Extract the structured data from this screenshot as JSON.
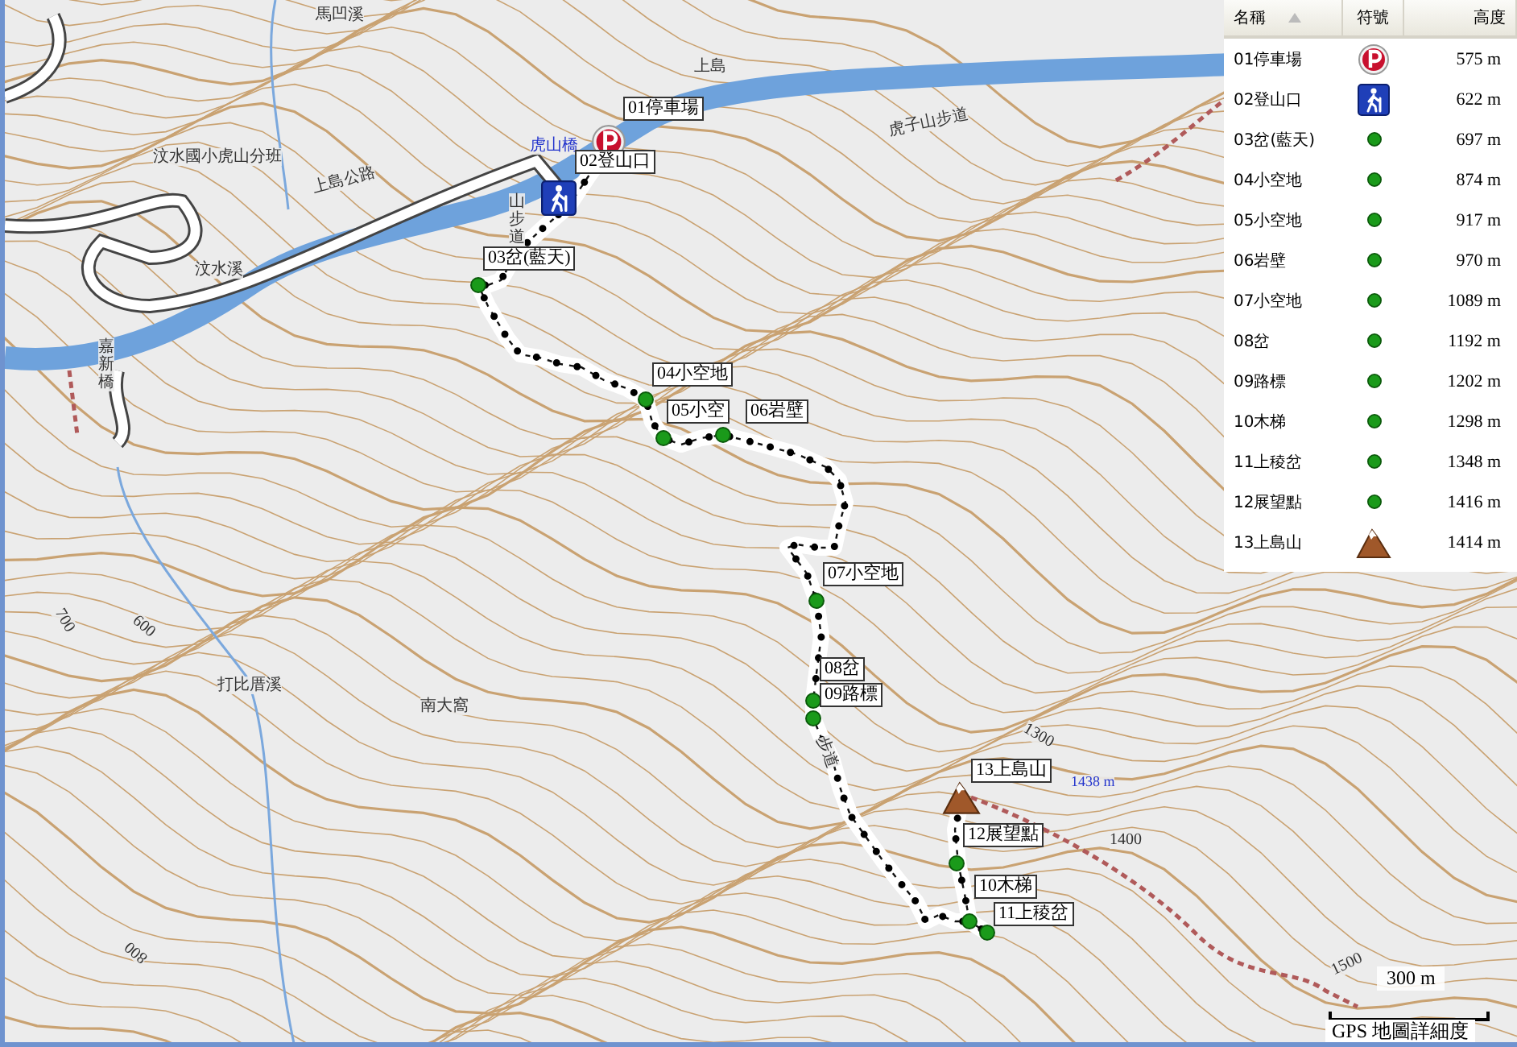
{
  "map": {
    "places": [
      {
        "text": "馬凹溪"
      },
      {
        "text": "上島"
      },
      {
        "text": "汶水國小虎山分班"
      },
      {
        "text": "虎山橋"
      },
      {
        "text": "上島公路"
      },
      {
        "text": "汶水溪"
      },
      {
        "text": "虎子山步道"
      },
      {
        "text": "山步道"
      },
      {
        "text": "嘉新橋"
      },
      {
        "text": "打比厝溪"
      },
      {
        "text": "南大窩"
      },
      {
        "text": "700"
      },
      {
        "text": "600"
      },
      {
        "text": "800"
      },
      {
        "text": "1300"
      },
      {
        "text": "1400"
      },
      {
        "text": "1500"
      },
      {
        "text": "1438 m"
      },
      {
        "text": "步道"
      }
    ],
    "waypoint_labels": [
      "01停車場",
      "02登山口",
      "03岔(藍天)",
      "04小空地",
      "05小空",
      "06岩壁",
      "07小空地",
      "08岔",
      "09路標",
      "13上島山",
      "12展望點",
      "10木梯",
      "11上稜岔"
    ],
    "scale": {
      "distance": "300 m",
      "caption": "GPS 地圖詳細度"
    }
  },
  "waypoint_list": {
    "columns": [
      "名稱",
      "符號",
      "高度"
    ],
    "rows": [
      {
        "name": "01停車場",
        "kind": "parking",
        "elevation": "575 m"
      },
      {
        "name": "02登山口",
        "kind": "trailhead",
        "elevation": "622 m"
      },
      {
        "name": "03岔(藍天)",
        "kind": "dot",
        "elevation": "697 m"
      },
      {
        "name": "04小空地",
        "kind": "dot",
        "elevation": "874 m"
      },
      {
        "name": "05小空地",
        "kind": "dot",
        "elevation": "917 m"
      },
      {
        "name": "06岩壁",
        "kind": "dot",
        "elevation": "970 m"
      },
      {
        "name": "07小空地",
        "kind": "dot",
        "elevation": "1089 m"
      },
      {
        "name": "08岔",
        "kind": "dot",
        "elevation": "1192 m"
      },
      {
        "name": "09路標",
        "kind": "dot",
        "elevation": "1202 m"
      },
      {
        "name": "10木梯",
        "kind": "dot",
        "elevation": "1298 m"
      },
      {
        "name": "11上稜岔",
        "kind": "dot",
        "elevation": "1348 m"
      },
      {
        "name": "12展望點",
        "kind": "dot",
        "elevation": "1416 m"
      },
      {
        "name": "13上島山",
        "kind": "summit",
        "elevation": "1414 m"
      }
    ]
  }
}
